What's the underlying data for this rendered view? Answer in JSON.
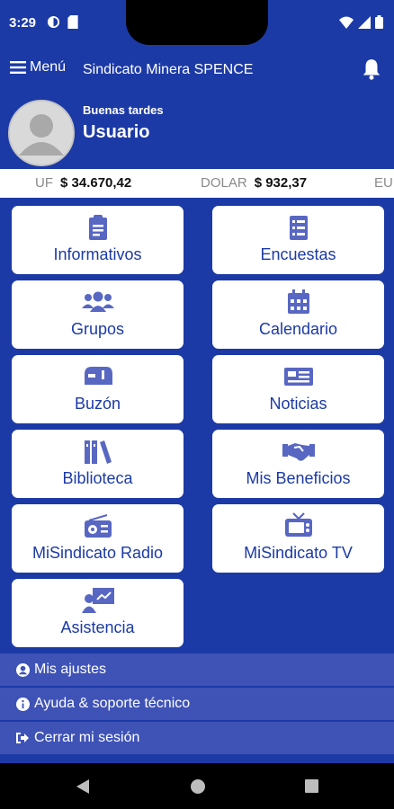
{
  "status": {
    "time": "3:29"
  },
  "appbar": {
    "menu_label": "Menú",
    "title": "Sindicato Minera SPENCE"
  },
  "profile": {
    "greeting": "Buenas tardes",
    "name": "Usuario"
  },
  "ticker": [
    {
      "label": "UF",
      "value": "$ 34.670,42"
    },
    {
      "label": "DOLAR",
      "value": "$ 932,37"
    },
    {
      "label": "EU",
      "value": ""
    }
  ],
  "tiles": [
    {
      "label": "Informativos",
      "icon": "clipboard-icon"
    },
    {
      "label": "Encuestas",
      "icon": "survey-list-icon"
    },
    {
      "label": "Grupos",
      "icon": "group-people-icon"
    },
    {
      "label": "Calendario",
      "icon": "calendar-icon"
    },
    {
      "label": "Buzón",
      "icon": "mailbox-icon"
    },
    {
      "label": "Noticias",
      "icon": "newspaper-icon"
    },
    {
      "label": "Biblioteca",
      "icon": "books-icon"
    },
    {
      "label": "Mis Beneficios",
      "icon": "handshake-icon"
    },
    {
      "label": "MiSindicato Radio",
      "icon": "radio-icon"
    },
    {
      "label": "MiSindicato TV",
      "icon": "tv-icon"
    },
    {
      "label": "Asistencia",
      "icon": "presenter-icon"
    }
  ],
  "settings": [
    {
      "label": "Mis ajustes",
      "icon": "user-circle-icon"
    },
    {
      "label": "Ayuda & soporte técnico",
      "icon": "info-circle-icon"
    },
    {
      "label": "Cerrar mi sesión",
      "icon": "sign-out-icon"
    }
  ],
  "colors": {
    "primary": "#1c3aa6",
    "row": "#3f53b6",
    "tile_bg": "#ffffff"
  }
}
